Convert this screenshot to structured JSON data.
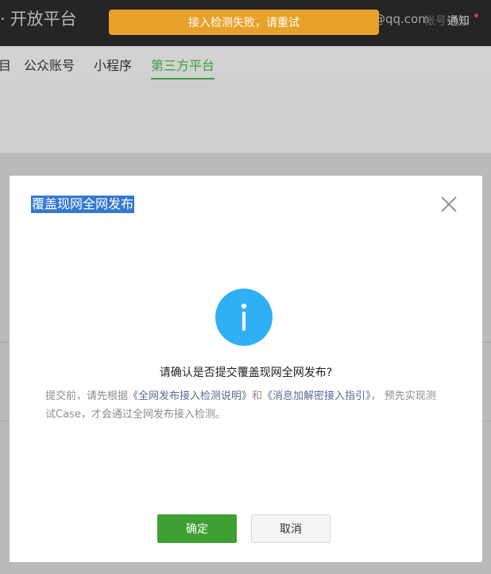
{
  "header": {
    "brand": "开放平台",
    "account": "@qq.com",
    "account_center": "帐号中心",
    "notice": "通知"
  },
  "toast": {
    "text": "接入检测失败，请重试"
  },
  "nav": {
    "items": [
      {
        "label": "目"
      },
      {
        "label": "公众账号"
      },
      {
        "label": "小程序"
      },
      {
        "label": "第三方平台"
      }
    ],
    "active_index": 3
  },
  "dialog": {
    "title": "覆盖现网全网发布",
    "question": "请确认是否提交覆盖现网全网发布?",
    "desc_prefix": "提交前，请先根据",
    "link1": "《全网发布接入检测说明》",
    "desc_and": "和",
    "link2": "《消息加解密接入指引》",
    "desc_suffix": "， 预先实现测试Case，才会通过全网发布接入检测。",
    "confirm_label": "确定",
    "cancel_label": "取消"
  },
  "colors": {
    "header_bg": "#2b2b2b",
    "toast_bg": "#e8a22b",
    "active_tab": "#44b549",
    "confirm_bg": "#3e9f33",
    "info_icon": "#2fb0f5",
    "link": "#576b95",
    "title_highlight": "#3478d0"
  },
  "icons": {
    "close": "close-icon",
    "info": "info-icon"
  }
}
